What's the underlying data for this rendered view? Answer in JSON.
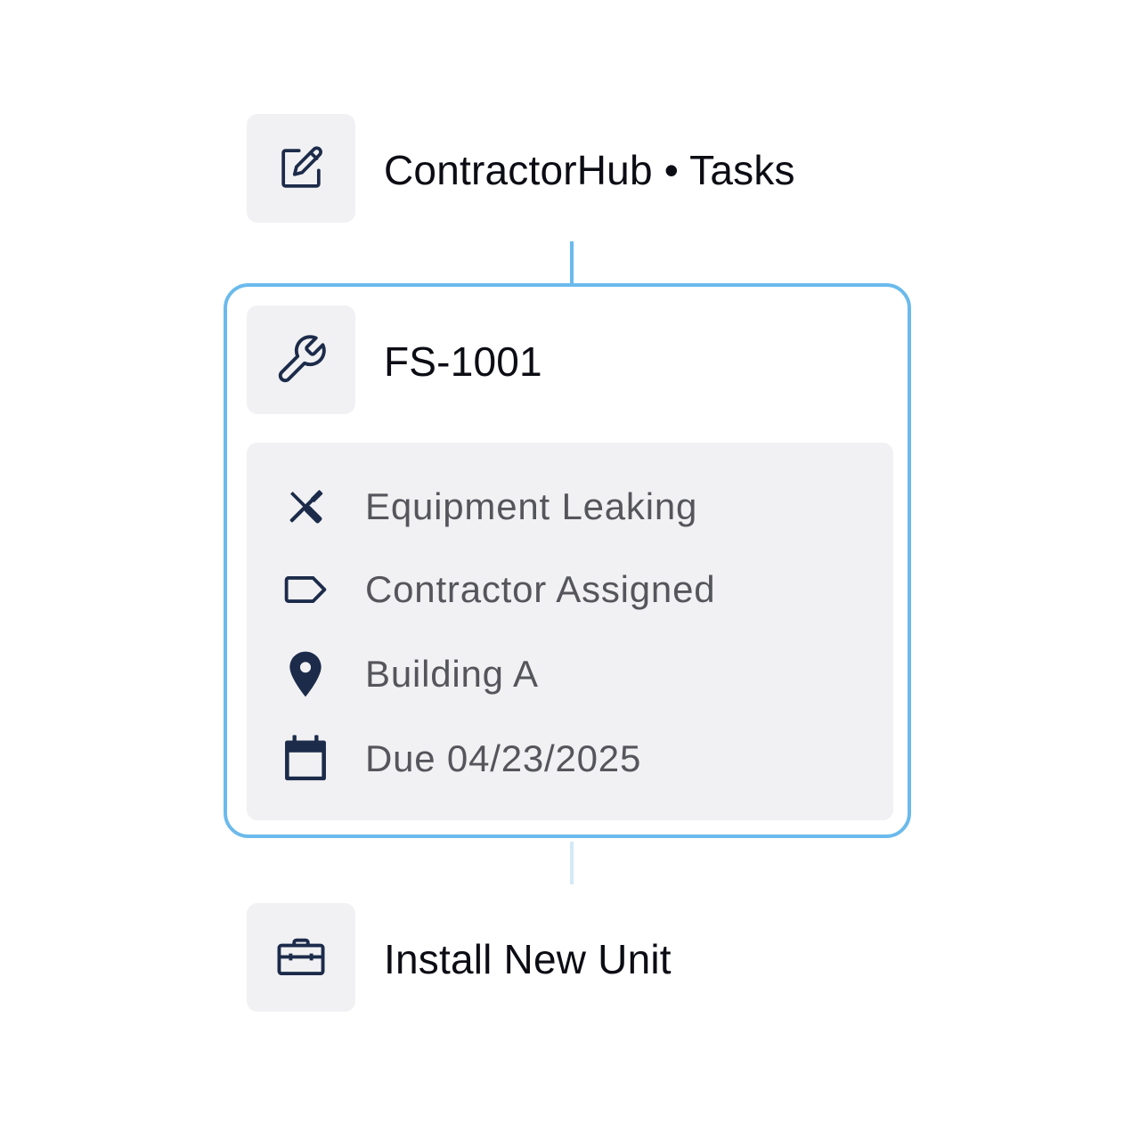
{
  "header": {
    "icon": "edit-square-icon",
    "title": "ContractorHub • Tasks"
  },
  "task": {
    "icon": "wrench-icon",
    "id": "FS-1001",
    "details": [
      {
        "icon": "tools-crossed-icon",
        "text": "Equipment Leaking"
      },
      {
        "icon": "tag-icon",
        "text": "Contractor Assigned"
      },
      {
        "icon": "location-pin-icon",
        "text": "Building A"
      },
      {
        "icon": "calendar-icon",
        "text": "Due 04/23/2025"
      }
    ]
  },
  "next_task": {
    "icon": "toolbox-icon",
    "title": "Install New Unit"
  },
  "colors": {
    "accent": "#6bbaec",
    "icon": "#1c2b4a",
    "tile_bg": "#f1f1f3",
    "detail_text": "#55555c"
  }
}
